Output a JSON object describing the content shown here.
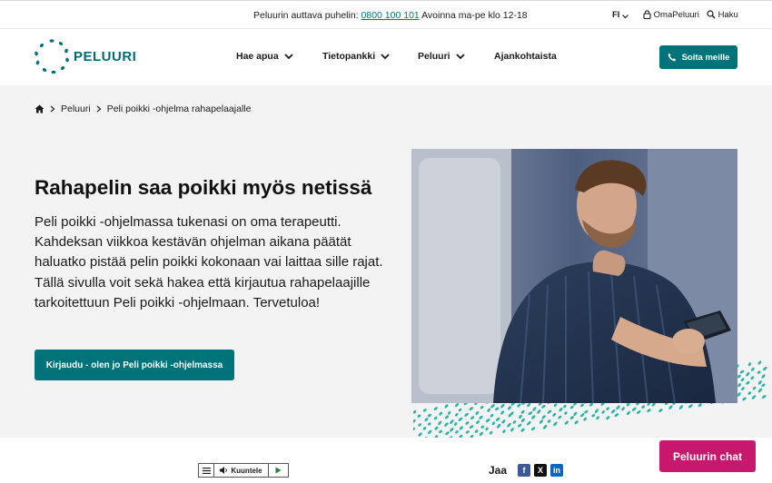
{
  "topbar": {
    "phone_label": "Peluurin auttava puhelin:",
    "phone_number": "0800 100 101",
    "phone_hours": "Avoinna ma-pe klo 12-18",
    "language": "FI",
    "oma_label": "OmaPeluuri",
    "search_label": "Haku"
  },
  "header": {
    "logo_text": "PELUURI",
    "nav": [
      "Hae apua",
      "Tietopankki",
      "Peluuri",
      "Ajankohtaista"
    ],
    "call_button": "Soita meille"
  },
  "breadcrumb": [
    "Peluuri",
    "Peli poikki -ohjelma rahapelaajalle"
  ],
  "hero": {
    "title": "Rahapelin saa poikki myös netissä",
    "lead": "Peli poikki -ohjelmassa tukenasi on oma terapeutti. Kahdeksan viikkoa kestävän ohjelman aikana päätät haluatko pistää pelin poikki kokonaan vai laittaa sille rajat. Tällä sivulla voit sekä hakea että kirjautua rahapelaajille tarkoitettuun Peli poikki -ohjelmaan. Tervetuloa!",
    "cta": "Kirjaudu - olen jo Peli poikki -ohjelmassa"
  },
  "bottom": {
    "listen_label": "Kuuntele",
    "share_label": "Jaa",
    "chat_button": "Peluurin chat"
  },
  "colors": {
    "brand": "#00737a",
    "chat": "#c8186e",
    "dots": "#2bb5a8"
  },
  "icons": [
    "phone-icon",
    "lock-icon",
    "search-icon",
    "chevron-down-icon",
    "home-icon",
    "facebook-icon",
    "x-icon",
    "linkedin-icon",
    "speaker-icon",
    "play-icon",
    "menu-icon"
  ]
}
